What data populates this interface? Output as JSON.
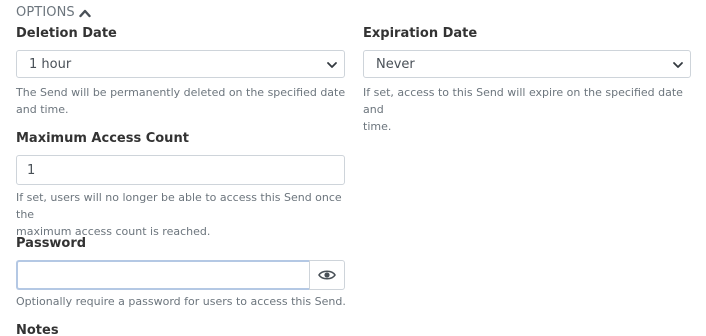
{
  "options": {
    "toggle_label": "OPTIONS",
    "toggle_icon": "chevron-up-icon"
  },
  "deletion": {
    "label": "Deletion Date",
    "value": "1 hour",
    "help_line1": "The Send will be permanently deleted on the specified date",
    "help_line2": "and time."
  },
  "expiration": {
    "label": "Expiration Date",
    "value": "Never",
    "help_line1": "If set, access to this Send will expire on the specified date and",
    "help_line2": "time."
  },
  "max_access": {
    "label": "Maximum Access Count",
    "value": "1",
    "help_line1": "If set, users will no longer be able to access this Send once the",
    "help_line2": "maximum access count is reached."
  },
  "password": {
    "label": "Password",
    "value": "",
    "toggle_icon": "eye-icon",
    "help": "Optionally require a password for users to access this Send."
  },
  "notes": {
    "label": "Notes"
  }
}
